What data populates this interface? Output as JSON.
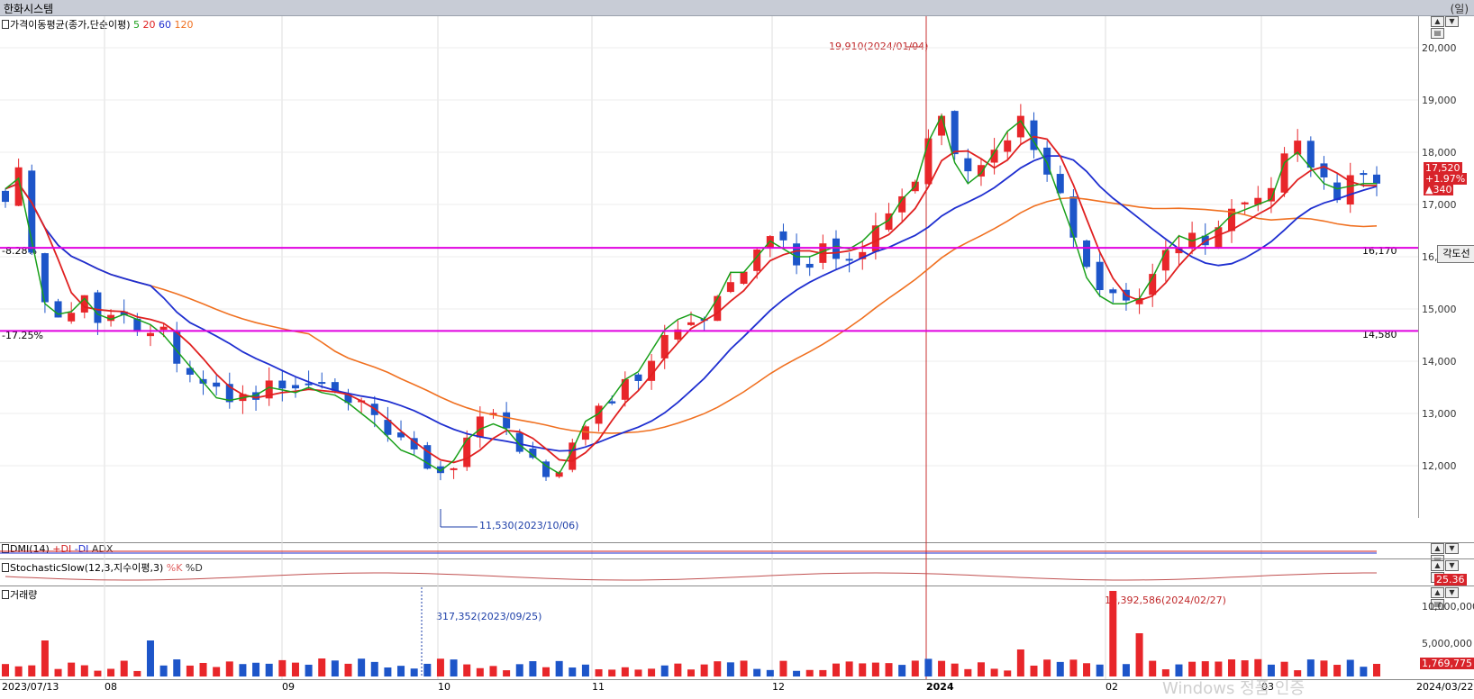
{
  "window": {
    "title": "한화시스템",
    "unit": "(일)"
  },
  "main_chart": {
    "legend_prefix": "가격이동평균(종가,단순이평)",
    "legend_periods": [
      {
        "label": "5",
        "color": "#1aa01a"
      },
      {
        "label": "20",
        "color": "#e02020"
      },
      {
        "label": "60",
        "color": "#1f2fd0"
      },
      {
        "label": "120",
        "color": "#f07020"
      }
    ],
    "y_ticks": [
      "20,000",
      "19,000",
      "18,000",
      "17,000",
      "16,000",
      "15,000",
      "14,000",
      "13,000",
      "12,000"
    ],
    "current": {
      "price": "17,520",
      "change_pct": "+1.97%",
      "change": "▲340"
    },
    "hlines": [
      {
        "value": "16,170",
        "left_label": "-8.28%"
      },
      {
        "value": "14,580",
        "left_label": "-17.25%"
      }
    ],
    "high_note": "19,910(2024/01/04)",
    "low_note": "11,530(2023/10/06)",
    "side_button": "각도선"
  },
  "dmi": {
    "label": "DMI(14)",
    "series": [
      "+DI",
      "-DI",
      "ADX"
    ]
  },
  "stochastic": {
    "label": "StochasticSlow(12,3,지수이평,3)",
    "series": [
      "%K",
      "%D"
    ],
    "value": "25.36"
  },
  "volume": {
    "label": "거래량",
    "y_ticks": [
      "10,000,000",
      "5,000,000"
    ],
    "current": "1,769,775",
    "max_note": "10,392,586(2024/02/27)",
    "min_note": "317,352(2023/09/25)"
  },
  "x_axis": {
    "labels": [
      "2023/07/13",
      "08",
      "09",
      "10",
      "11",
      "12",
      "2024",
      "02",
      "03",
      "2024/03/22"
    ]
  },
  "controls": {
    "up": "▲",
    "down": "▼",
    "menu": "▤"
  },
  "colors": {
    "up": "#e8262a",
    "down": "#1d55c9",
    "ma5": "#1aa01a",
    "ma20": "#e02020",
    "ma60": "#1f2fd0",
    "ma120": "#f07020",
    "hline": "#e000e0"
  },
  "watermark": "Windows 정품 인증",
  "chart_data": {
    "type": "candlestick",
    "ylim": [
      11000,
      20500
    ],
    "series": [
      {
        "name": "5",
        "values": [
          17300,
          17500,
          16300,
          15100,
          14900,
          14950,
          15200,
          14900,
          14800,
          14900,
          14800,
          14700,
          14500,
          14200,
          13900,
          13600,
          13300,
          13250,
          13300,
          13350,
          13500,
          13450,
          13400,
          13500,
          13400,
          13350,
          13200,
          13000,
          12800,
          12550,
          12300,
          12200,
          12050,
          11900,
          12100,
          12500,
          12700,
          12800,
          12700,
          12400,
          12200,
          12000,
          11850,
          12300,
          12850,
          13000,
          13300,
          13650,
          13800,
          14200,
          14600,
          14800,
          14900,
          14800,
          15200,
          15700,
          15700,
          16000,
          16300,
          16150,
          16000,
          16000,
          16100,
          16200,
          16150,
          16300,
          16550,
          16700,
          17100,
          17350,
          18200,
          18700,
          17800,
          17400,
          17600,
          18000,
          18400,
          18600,
          18200,
          17800,
          17100,
          16400,
          15600,
          15250,
          15100,
          15100,
          15200,
          15600,
          16100,
          16400,
          16300,
          16400,
          16550,
          16800,
          16900,
          17000,
          17100,
          17800,
          18000,
          17700,
          17400,
          17300,
          17350,
          17400,
          17400
        ]
      }
    ]
  }
}
